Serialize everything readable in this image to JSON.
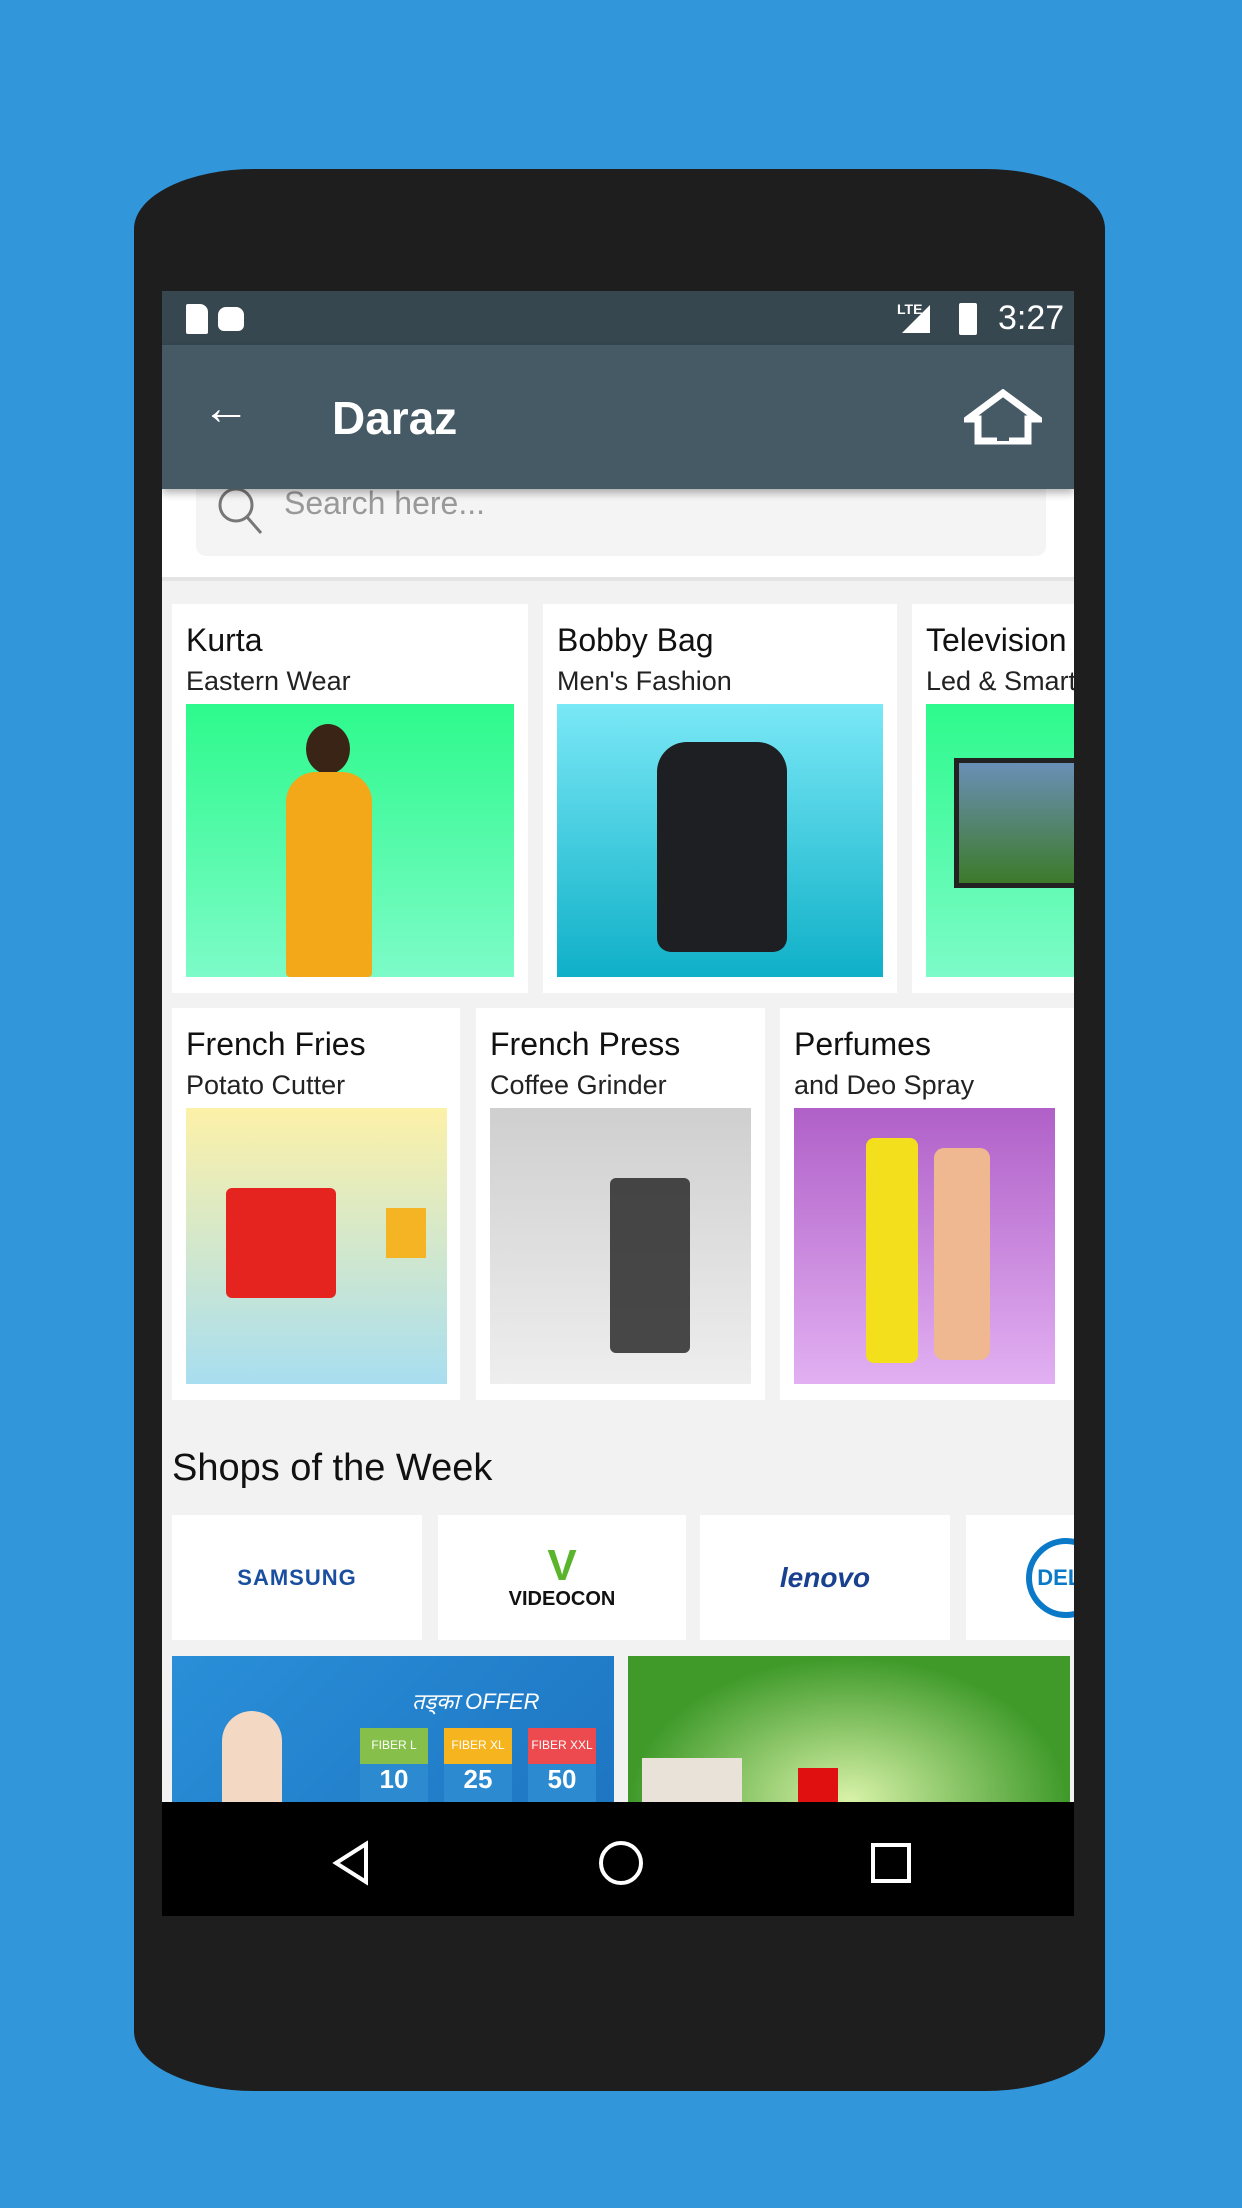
{
  "status_bar": {
    "time": "3:27",
    "network": "LTE",
    "icons": [
      "sd-card-icon",
      "android-icon",
      "signal-icon",
      "battery-charging-icon"
    ]
  },
  "toolbar": {
    "title": "Daraz",
    "back_icon": "arrow-left-icon",
    "home_icon": "home-icon"
  },
  "search": {
    "placeholder": "Search here..."
  },
  "categories_row1": [
    {
      "title": "Kurta",
      "subtitle": "Eastern Wear"
    },
    {
      "title": "Bobby Bag",
      "subtitle": "Men's Fashion"
    },
    {
      "title": "Television",
      "subtitle": "Led & Smart"
    }
  ],
  "categories_row2": [
    {
      "title": "French Fries",
      "subtitle": "Potato Cutter"
    },
    {
      "title": "French Press",
      "subtitle": "Coffee Grinder"
    },
    {
      "title": "Perfumes",
      "subtitle": "and Deo Spray"
    }
  ],
  "shops": {
    "heading": "Shops of the Week",
    "brands": [
      "SAMSUNG",
      "VIDEOCON",
      "lenovo",
      "DELL"
    ]
  },
  "banners": {
    "offer_title": "तड्का OFFER",
    "plans": [
      {
        "name": "FIBER L",
        "value": "10"
      },
      {
        "name": "FIBER XL",
        "value": "25"
      },
      {
        "name": "FIBER XXL",
        "value": "50"
      }
    ]
  },
  "colors": {
    "background": "#3296db",
    "toolbar": "#455a64",
    "status_bar": "#37474f"
  }
}
